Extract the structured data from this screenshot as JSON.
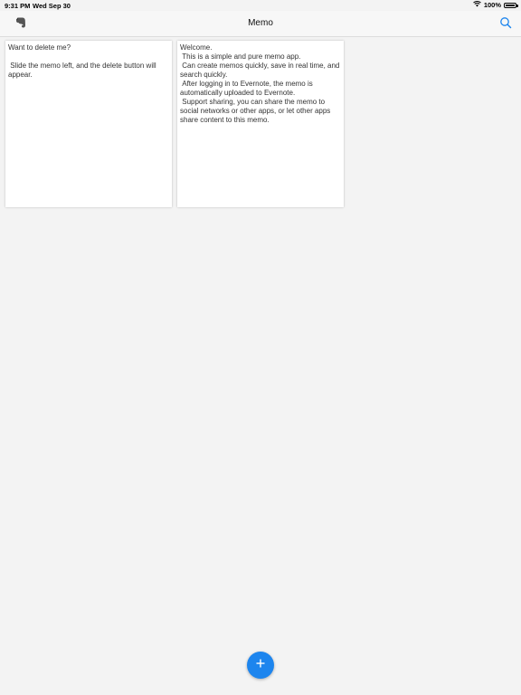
{
  "status": {
    "time": "9:31 PM",
    "date": "Wed Sep 30",
    "battery": "100%",
    "battery_level": 1.0,
    "icons": [
      "wifi-icon",
      "battery-icon"
    ]
  },
  "nav": {
    "title": "Memo",
    "left_icon": "evernote-icon",
    "right_icon": "search-icon",
    "accent": "#1d85ee"
  },
  "memos": [
    {
      "text": "Want to delete me?\n\n Slide the memo left, and the delete button will appear."
    },
    {
      "text": "Welcome.\n This is a simple and pure memo app.\n Can create memos quickly, save in real time, and search quickly.\n After logging in to Evernote, the memo is automatically uploaded to Evernote.\n Support sharing, you can share the memo to social networks or other apps, or let other apps share content to this memo."
    }
  ],
  "fab": {
    "icon": "plus-icon",
    "color": "#1d85ee"
  }
}
